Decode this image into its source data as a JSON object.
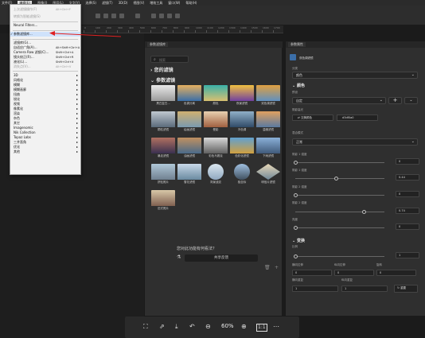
{
  "menubar": {
    "items": [
      "文件(F)",
      "编辑(E)",
      "图像(I)",
      "图层(L)",
      "文字(Y)",
      "选择(S)",
      "滤镜(T)",
      "3D(D)",
      "视图(V)",
      "增效工具",
      "窗口(W)",
      "帮助(H)"
    ],
    "active_index": 1
  },
  "ruler": {
    "ticks": [
      "0",
      "100",
      "200",
      "300",
      "400",
      "500",
      "600",
      "700",
      "800",
      "900",
      "1000",
      "1100",
      "1200",
      "1300",
      "1400",
      "1500",
      "1600",
      "1700",
      "1800"
    ]
  },
  "edit_menu": {
    "items": [
      {
        "label": "上次滤镜操作(F)",
        "shortcut": "Alt+Ctrl+F",
        "disabled": true
      },
      {
        "label": "转换为智能滤镜(S)",
        "shortcut": "",
        "disabled": true
      },
      {
        "label": "Neural Filters...",
        "shortcut": "",
        "disabled": false
      },
      {
        "label": "参数滤镜库...",
        "shortcut": "",
        "disabled": false,
        "checked": true,
        "selected": true
      },
      {
        "label": "滤镜库(G)...",
        "shortcut": "",
        "disabled": false
      },
      {
        "label": "自适应广角(A)...",
        "shortcut": "Alt+Shift+Ctrl+A",
        "disabled": false
      },
      {
        "label": "Camera Raw 滤镜(C)...",
        "shortcut": "Shift+Ctrl+A",
        "disabled": false
      },
      {
        "label": "镜头校正(R)...",
        "shortcut": "Shift+Ctrl+R",
        "disabled": false
      },
      {
        "label": "液化(L)...",
        "shortcut": "Shift+Ctrl+X",
        "disabled": false
      },
      {
        "label": "消失点(V)...",
        "shortcut": "Alt+Ctrl+V",
        "disabled": true
      },
      {
        "label": "3D",
        "submenu": true
      },
      {
        "label": "风格化",
        "submenu": true
      },
      {
        "label": "模糊",
        "submenu": true
      },
      {
        "label": "模糊画廊",
        "submenu": true
      },
      {
        "label": "扭曲",
        "submenu": true
      },
      {
        "label": "锐化",
        "submenu": true
      },
      {
        "label": "视频",
        "submenu": true
      },
      {
        "label": "像素化",
        "submenu": true
      },
      {
        "label": "渲染",
        "submenu": true
      },
      {
        "label": "杂色",
        "submenu": true
      },
      {
        "label": "其它",
        "submenu": true
      },
      {
        "label": "Imagenomic",
        "submenu": true
      },
      {
        "label": "Nik Collection",
        "submenu": true
      },
      {
        "label": "Topaz Labs",
        "submenu": true
      },
      {
        "label": "三井直角",
        "submenu": true
      },
      {
        "label": "优化",
        "submenu": true
      },
      {
        "label": "其他",
        "submenu": true
      }
    ]
  },
  "filters_panel": {
    "tab": "参数滤镜库",
    "search_placeholder": "搜索",
    "your_filters": "您的滤镜",
    "param_filters": "参数滤镜",
    "thumbs": [
      {
        "label": "黑白复古..."
      },
      {
        "label": "色调分离"
      },
      {
        "label": "颜色"
      },
      {
        "label": "夜景滤镜"
      },
      {
        "label": "双色调滤镜"
      },
      {
        "label": "颗粒滤镜"
      },
      {
        "label": "绘画滤镜"
      },
      {
        "label": "晕影"
      },
      {
        "label": "冷色调"
      },
      {
        "label": "温暖滤镜"
      },
      {
        "label": "暴走滤镜"
      },
      {
        "label": "油画滤镜"
      },
      {
        "label": "彩色马赛克"
      },
      {
        "label": "色彩化滤镜"
      },
      {
        "label": "下雨滤镜"
      },
      {
        "label": "拼贴照片"
      },
      {
        "label": "雪花滤镜"
      },
      {
        "label": "背景波纹"
      },
      {
        "label": "极坐标"
      },
      {
        "label": "明信片滤镜"
      },
      {
        "label": "旧式照片"
      }
    ],
    "feedback_question": "您对此功能有何看法？",
    "share_label": "共享反馈"
  },
  "props_panel": {
    "tab": "参数属性",
    "layer_name": "双色调滤镜",
    "category_label": "分类",
    "category_value": "颜色",
    "color_section": "颜色",
    "preset_label": "预设",
    "preset_value": "自定",
    "highlight_label": "阴影高光",
    "swap_label": "交换颜色",
    "hex_value": "d3df0a0",
    "blend_label": "混合模式",
    "blend_value": "正常",
    "s1_label": "阴影 1 强度",
    "s1_value": "0",
    "s2_label": "阴影 1 强度",
    "s2_value": "0.44",
    "s3_label": "阴影 2 强度",
    "s3_value": "0",
    "s4_label": "阴影 2 强度",
    "s4_value": "0.74",
    "s5_label": "亮度",
    "s5_value": "0",
    "transform_section": "变换",
    "scale_label": "比例",
    "scale_value": "1",
    "hstretch_label": "横向拉伸",
    "vstretch_label": "纵向拉伸",
    "rotate_label": "旋转",
    "h_value": "0",
    "v_value": "0",
    "r_value": "0",
    "hflip_label": "横向重复",
    "vflip_label": "纵向重复",
    "hrep_value": "1",
    "vrep_value": "1",
    "reset_label": "重置"
  },
  "bottombar": {
    "zoom": "60%"
  }
}
